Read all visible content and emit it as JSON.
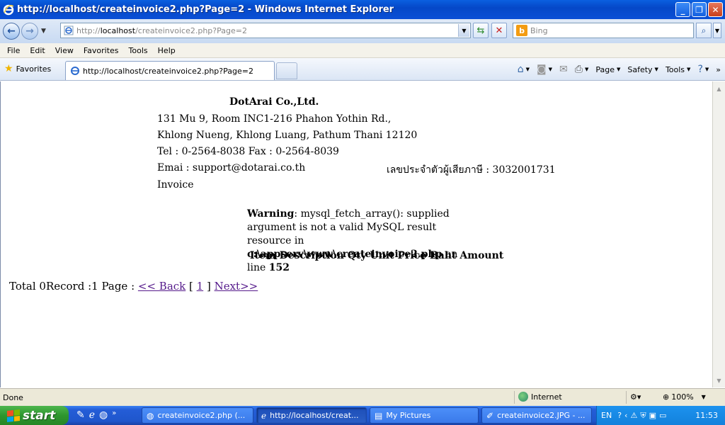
{
  "window": {
    "title": "http://localhost/createinvoice2.php?Page=2 - Windows Internet Explorer"
  },
  "address": {
    "url_prefix": "http://",
    "url_host": "localhost",
    "url_path": "/createinvoice2.php?Page=2"
  },
  "search": {
    "placeholder": "Bing"
  },
  "menu": [
    "File",
    "Edit",
    "View",
    "Favorites",
    "Tools",
    "Help"
  ],
  "favbar": {
    "favorites_label": "Favorites",
    "tab_title": "http://localhost/createinvoice2.php?Page=2",
    "commands": {
      "page": "Page",
      "safety": "Safety",
      "tools": "Tools"
    }
  },
  "page": {
    "company_name": "DotArai Co.,Ltd.",
    "address_line1": "131 Mu 9, Room INC1-216 Phahon Yothin Rd.,",
    "address_line2": "Khlong Nueng, Khlong Luang, Pathum Thani 12120",
    "phone_line": "Tel : 0-2564-8038 Fax : 0-2564-8039",
    "email_line": "Emai : support@dotarai.co.th",
    "tax_id_line": "เลขประจำตัวผู้เสียภาษี : 3032001731",
    "doc_type": "Invoice",
    "warning": {
      "label": "Warning",
      "message": ": mysql_fetch_array(): supplied argument is not a valid MySQL result resource in",
      "file": "c:\\appserv\\www\\createinvoice2.php",
      "on_line": " on line ",
      "line_no": "152"
    },
    "table_header": "Item Description Qty Unit Price Baht Amount",
    "pager": {
      "summary": "Total 0Record :1 Page : ",
      "back": "<< Back",
      "open_bracket": " [ ",
      "page_num": "1",
      "close_bracket": " ] ",
      "next": "Next>>"
    }
  },
  "status": {
    "text": "Done",
    "zone": "Internet",
    "zoom": "100%"
  },
  "taskbar": {
    "start": "start",
    "tasks": [
      {
        "label": "createinvoice2.php (..."
      },
      {
        "label": "http://localhost/creat..."
      },
      {
        "label": "My Pictures"
      },
      {
        "label": "createinvoice2.JPG - ..."
      }
    ],
    "lang": "EN",
    "clock": "11:53"
  }
}
